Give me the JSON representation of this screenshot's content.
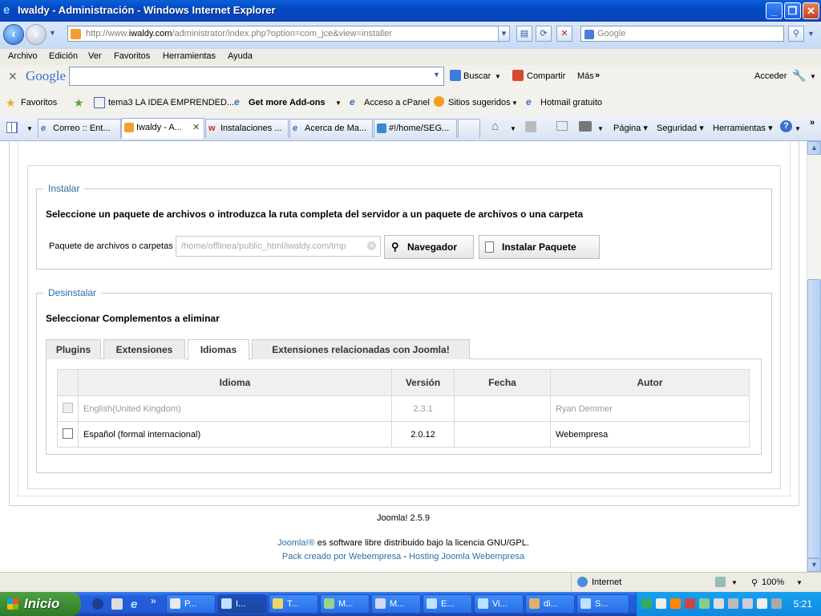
{
  "window": {
    "title": "Iwaldy - Administración - Windows Internet Explorer",
    "minimize": "_",
    "maximize": "❐",
    "close": "✕"
  },
  "address_bar": {
    "url_prefix": "http://www.",
    "url_domain": "iwaldy.com",
    "url_rest": "/administrator/index.php?option=com_jce&view=installer",
    "search_placeholder": "Google"
  },
  "menu": [
    "Archivo",
    "Edición",
    "Ver",
    "Favoritos",
    "Herramientas",
    "Ayuda"
  ],
  "google_toolbar": {
    "logo": "Google",
    "buscar": "Buscar",
    "compartir": "Compartir",
    "mas": "Más",
    "acceder": "Acceder"
  },
  "favorites_bar": {
    "label": "Favoritos",
    "items": [
      "tema3 LA IDEA EMPRENDED...",
      "Get more Add-ons",
      "Acceso a cPanel",
      "Sitios sugeridos",
      "Hotmail gratuito"
    ]
  },
  "tabs": [
    {
      "label": "Correo :: Ent...",
      "active": false
    },
    {
      "label": "Iwaldy - A...",
      "active": true
    },
    {
      "label": "Instalaciones ...",
      "active": false
    },
    {
      "label": "Acerca de Ma...",
      "active": false
    },
    {
      "label": "#!/home/SEG...",
      "active": false
    }
  ],
  "command_bar": {
    "pagina": "Página",
    "seguridad": "Seguridad",
    "herramientas": "Herramientas"
  },
  "install_section": {
    "legend": "Instalar",
    "heading": "Seleccione un paquete de archivos o introduzca la ruta completa del servidor a un paquete de archivos o una carpeta",
    "field_label": "Paquete de archivos o carpetas",
    "field_value": "/home/offlinea/public_html/iwaldy.com/tmp",
    "browse_button": "Navegador",
    "install_button": "Instalar Paquete"
  },
  "uninstall_section": {
    "legend": "Desinstalar",
    "heading": "Seleccionar Complementos a eliminar",
    "tabs": [
      "Plugins",
      "Extensiones",
      "Idiomas",
      "Extensiones relacionadas con Joomla!"
    ],
    "active_tab": "Idiomas",
    "columns": [
      "Idioma",
      "Versión",
      "Fecha",
      "Autor"
    ],
    "rows": [
      {
        "idioma": "English(United Kingdom)",
        "version": "2.3.1",
        "fecha": "",
        "autor": "Ryan Demmer",
        "disabled": true
      },
      {
        "idioma": "Español (formal internacional)",
        "version": "2.0.12",
        "fecha": "",
        "autor": "Webempresa",
        "disabled": false
      }
    ]
  },
  "footer": {
    "version": "Joomla! 2.5.9",
    "license_link": "Joomla!®",
    "license_text": " es software libre distribuido bajo la licencia GNU/GPL.",
    "pack": "Pack creado por Webempresa",
    "sep": " - ",
    "hosting": "Hosting Joomla Webempresa"
  },
  "status_bar": {
    "zone": "Internet",
    "zoom": "100%"
  },
  "taskbar": {
    "start": "Inicio",
    "buttons": [
      "P...",
      "I...",
      "T...",
      "M...",
      "M...",
      "E...",
      "Vi...",
      "di...",
      "S..."
    ],
    "clock": "5:21"
  }
}
